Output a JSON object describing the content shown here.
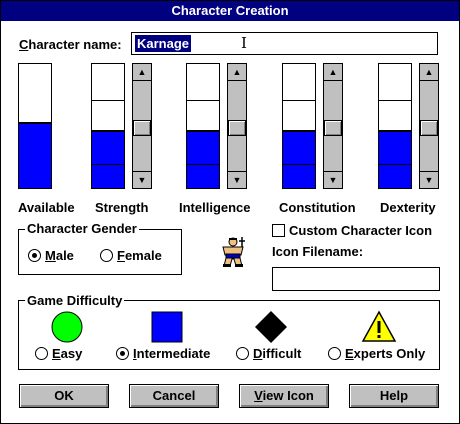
{
  "window": {
    "title": "Character Creation"
  },
  "character_name": {
    "label_pre": "C",
    "label_rest": "haracter name:",
    "value": "Karnage"
  },
  "stats": [
    {
      "name": "Available",
      "level": 0.52
    },
    {
      "name": "Strength",
      "level": 0.45
    },
    {
      "name": "Intelligence",
      "level": 0.45
    },
    {
      "name": "Constitution",
      "level": 0.45
    },
    {
      "name": "Dexterity",
      "level": 0.45
    }
  ],
  "gender": {
    "title": "Character Gender",
    "options": [
      {
        "pre": "M",
        "rest": "ale",
        "selected": true
      },
      {
        "pre": "F",
        "rest": "emale",
        "selected": false
      }
    ]
  },
  "custom_icon": {
    "label": "Custom Character Icon",
    "checked": false,
    "filename_label": "Icon Filename:",
    "filename_value": ""
  },
  "difficulty": {
    "title": "Game Difficulty",
    "options": [
      {
        "pre": "E",
        "rest": "asy",
        "selected": false,
        "icon": "green-circle-icon",
        "color": "#00ff00"
      },
      {
        "pre": "I",
        "rest": "ntermediate",
        "selected": true,
        "icon": "blue-square-icon",
        "color": "#0000ff"
      },
      {
        "pre": "D",
        "rest": "ifficult",
        "selected": false,
        "icon": "black-diamond-icon",
        "color": "#000000"
      },
      {
        "pre": "E",
        "rest": "xperts Only",
        "selected": false,
        "icon": "warning-triangle-icon",
        "color": "#ffff00"
      }
    ]
  },
  "buttons": {
    "ok": "OK",
    "cancel": "Cancel",
    "view_icon_pre": "V",
    "view_icon_rest": "iew Icon",
    "help": "Help"
  }
}
